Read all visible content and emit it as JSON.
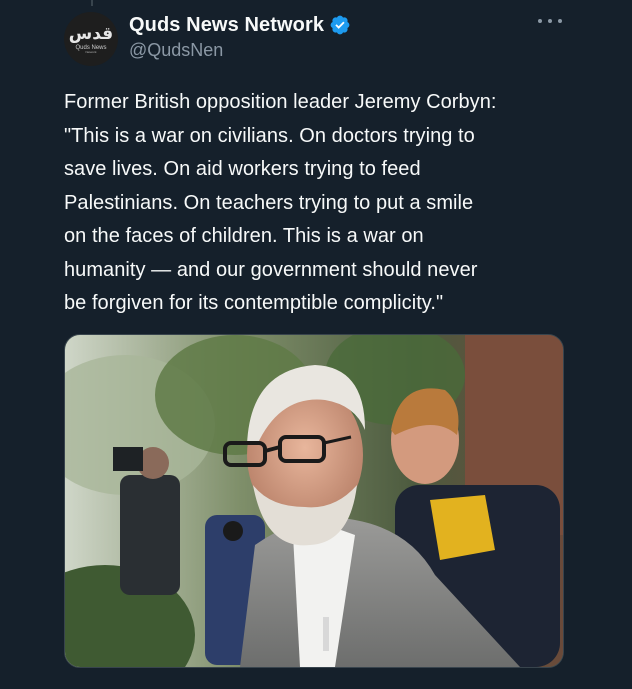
{
  "tweet": {
    "author": {
      "display_name": "Quds News Network",
      "handle": "@QudsNen",
      "verified": true,
      "avatar": {
        "logo_text": "قدس",
        "logo_subtitle": "Quds News",
        "logo_tagline": "Network"
      }
    },
    "more_icon": "ellipsis-icon",
    "text": "Former British opposition leader Jeremy Corbyn:\n\"This is a war on civilians. On doctors trying to\nsave lives. On aid workers trying to feed\nPalestinians. On teachers trying to put a smile\non the faces of children. This is a war on\nhumanity — and our government should never\nbe forgiven for its contemptible complicity.\"",
    "media": {
      "type": "photo"
    }
  },
  "colors": {
    "background": "#15202b",
    "text_primary": "#f7f9f9",
    "text_secondary": "#8b98a5",
    "verified_blue": "#1d9bf0",
    "border": "#38444d"
  }
}
